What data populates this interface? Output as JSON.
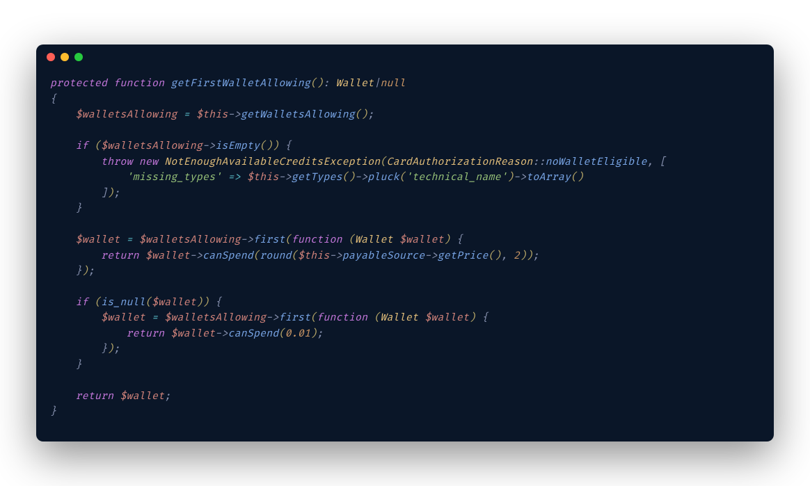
{
  "code": {
    "lines": [
      {
        "indent": 0,
        "tokens": [
          {
            "t": "kw",
            "v": "protected"
          },
          {
            "t": "sp",
            "v": " "
          },
          {
            "t": "kw",
            "v": "function"
          },
          {
            "t": "sp",
            "v": " "
          },
          {
            "t": "fn",
            "v": "getFirstWalletAllowing"
          },
          {
            "t": "paren",
            "v": "()"
          },
          {
            "t": "punct",
            "v": ": "
          },
          {
            "t": "type",
            "v": "Wallet"
          },
          {
            "t": "punct",
            "v": "|"
          },
          {
            "t": "null",
            "v": "null"
          }
        ]
      },
      {
        "indent": 0,
        "tokens": [
          {
            "t": "brace",
            "v": "{"
          }
        ]
      },
      {
        "indent": 1,
        "tokens": [
          {
            "t": "var",
            "v": "$walletsAllowing"
          },
          {
            "t": "sp",
            "v": " "
          },
          {
            "t": "op",
            "v": "="
          },
          {
            "t": "sp",
            "v": " "
          },
          {
            "t": "var",
            "v": "$this"
          },
          {
            "t": "arrow",
            "v": "->"
          },
          {
            "t": "method",
            "v": "getWalletsAllowing"
          },
          {
            "t": "paren",
            "v": "()"
          },
          {
            "t": "punct",
            "v": ";"
          }
        ]
      },
      {
        "indent": 0,
        "tokens": []
      },
      {
        "indent": 1,
        "tokens": [
          {
            "t": "kw",
            "v": "if"
          },
          {
            "t": "sp",
            "v": " "
          },
          {
            "t": "paren",
            "v": "("
          },
          {
            "t": "var",
            "v": "$walletsAllowing"
          },
          {
            "t": "arrow",
            "v": "->"
          },
          {
            "t": "method",
            "v": "isEmpty"
          },
          {
            "t": "paren",
            "v": "())"
          },
          {
            "t": "sp",
            "v": " "
          },
          {
            "t": "brace",
            "v": "{"
          }
        ]
      },
      {
        "indent": 2,
        "tokens": [
          {
            "t": "kw",
            "v": "throw"
          },
          {
            "t": "sp",
            "v": " "
          },
          {
            "t": "kw",
            "v": "new"
          },
          {
            "t": "sp",
            "v": " "
          },
          {
            "t": "type",
            "v": "NotEnoughAvailableCreditsException"
          },
          {
            "t": "paren",
            "v": "("
          },
          {
            "t": "type",
            "v": "CardAuthorizationReason"
          },
          {
            "t": "scope",
            "v": "::"
          },
          {
            "t": "method",
            "v": "noWalletEligible"
          },
          {
            "t": "punct",
            "v": ", "
          },
          {
            "t": "bracket",
            "v": "["
          }
        ]
      },
      {
        "indent": 3,
        "tokens": [
          {
            "t": "str",
            "v": "'missing_types'"
          },
          {
            "t": "sp",
            "v": " "
          },
          {
            "t": "op",
            "v": "=>"
          },
          {
            "t": "sp",
            "v": " "
          },
          {
            "t": "var",
            "v": "$this"
          },
          {
            "t": "arrow",
            "v": "->"
          },
          {
            "t": "method",
            "v": "getTypes"
          },
          {
            "t": "paren",
            "v": "()"
          },
          {
            "t": "arrow",
            "v": "->"
          },
          {
            "t": "method",
            "v": "pluck"
          },
          {
            "t": "paren",
            "v": "("
          },
          {
            "t": "str",
            "v": "'technical_name'"
          },
          {
            "t": "paren",
            "v": ")"
          },
          {
            "t": "arrow",
            "v": "->"
          },
          {
            "t": "method",
            "v": "toArray"
          },
          {
            "t": "paren",
            "v": "()"
          }
        ]
      },
      {
        "indent": 2,
        "tokens": [
          {
            "t": "bracket",
            "v": "]"
          },
          {
            "t": "paren",
            "v": ")"
          },
          {
            "t": "punct",
            "v": ";"
          }
        ]
      },
      {
        "indent": 1,
        "tokens": [
          {
            "t": "brace",
            "v": "}"
          }
        ]
      },
      {
        "indent": 0,
        "tokens": []
      },
      {
        "indent": 1,
        "tokens": [
          {
            "t": "var",
            "v": "$wallet"
          },
          {
            "t": "sp",
            "v": " "
          },
          {
            "t": "op",
            "v": "="
          },
          {
            "t": "sp",
            "v": " "
          },
          {
            "t": "var",
            "v": "$walletsAllowing"
          },
          {
            "t": "arrow",
            "v": "->"
          },
          {
            "t": "method",
            "v": "first"
          },
          {
            "t": "paren",
            "v": "("
          },
          {
            "t": "kw",
            "v": "function"
          },
          {
            "t": "sp",
            "v": " "
          },
          {
            "t": "paren",
            "v": "("
          },
          {
            "t": "type",
            "v": "Wallet"
          },
          {
            "t": "sp",
            "v": " "
          },
          {
            "t": "var",
            "v": "$wallet"
          },
          {
            "t": "paren",
            "v": ")"
          },
          {
            "t": "sp",
            "v": " "
          },
          {
            "t": "brace",
            "v": "{"
          }
        ]
      },
      {
        "indent": 2,
        "tokens": [
          {
            "t": "kw",
            "v": "return"
          },
          {
            "t": "sp",
            "v": " "
          },
          {
            "t": "var",
            "v": "$wallet"
          },
          {
            "t": "arrow",
            "v": "->"
          },
          {
            "t": "method",
            "v": "canSpend"
          },
          {
            "t": "paren",
            "v": "("
          },
          {
            "t": "builtin",
            "v": "round"
          },
          {
            "t": "paren",
            "v": "("
          },
          {
            "t": "var",
            "v": "$this"
          },
          {
            "t": "arrow",
            "v": "->"
          },
          {
            "t": "method",
            "v": "payableSource"
          },
          {
            "t": "arrow",
            "v": "->"
          },
          {
            "t": "method",
            "v": "getPrice"
          },
          {
            "t": "paren",
            "v": "()"
          },
          {
            "t": "punct",
            "v": ", "
          },
          {
            "t": "num",
            "v": "2"
          },
          {
            "t": "paren",
            "v": "))"
          },
          {
            "t": "punct",
            "v": ";"
          }
        ]
      },
      {
        "indent": 1,
        "tokens": [
          {
            "t": "brace",
            "v": "}"
          },
          {
            "t": "paren",
            "v": ")"
          },
          {
            "t": "punct",
            "v": ";"
          }
        ]
      },
      {
        "indent": 0,
        "tokens": []
      },
      {
        "indent": 1,
        "tokens": [
          {
            "t": "kw",
            "v": "if"
          },
          {
            "t": "sp",
            "v": " "
          },
          {
            "t": "paren",
            "v": "("
          },
          {
            "t": "builtin",
            "v": "is_null"
          },
          {
            "t": "paren",
            "v": "("
          },
          {
            "t": "var",
            "v": "$wallet"
          },
          {
            "t": "paren",
            "v": "))"
          },
          {
            "t": "sp",
            "v": " "
          },
          {
            "t": "brace",
            "v": "{"
          }
        ]
      },
      {
        "indent": 2,
        "tokens": [
          {
            "t": "var",
            "v": "$wallet"
          },
          {
            "t": "sp",
            "v": " "
          },
          {
            "t": "op",
            "v": "="
          },
          {
            "t": "sp",
            "v": " "
          },
          {
            "t": "var",
            "v": "$walletsAllowing"
          },
          {
            "t": "arrow",
            "v": "->"
          },
          {
            "t": "method",
            "v": "first"
          },
          {
            "t": "paren",
            "v": "("
          },
          {
            "t": "kw",
            "v": "function"
          },
          {
            "t": "sp",
            "v": " "
          },
          {
            "t": "paren",
            "v": "("
          },
          {
            "t": "type",
            "v": "Wallet"
          },
          {
            "t": "sp",
            "v": " "
          },
          {
            "t": "var",
            "v": "$wallet"
          },
          {
            "t": "paren",
            "v": ")"
          },
          {
            "t": "sp",
            "v": " "
          },
          {
            "t": "brace",
            "v": "{"
          }
        ]
      },
      {
        "indent": 3,
        "tokens": [
          {
            "t": "kw",
            "v": "return"
          },
          {
            "t": "sp",
            "v": " "
          },
          {
            "t": "var",
            "v": "$wallet"
          },
          {
            "t": "arrow",
            "v": "->"
          },
          {
            "t": "method",
            "v": "canSpend"
          },
          {
            "t": "paren",
            "v": "("
          },
          {
            "t": "num",
            "v": "0.01"
          },
          {
            "t": "paren",
            "v": ")"
          },
          {
            "t": "punct",
            "v": ";"
          }
        ]
      },
      {
        "indent": 2,
        "tokens": [
          {
            "t": "brace",
            "v": "}"
          },
          {
            "t": "paren",
            "v": ")"
          },
          {
            "t": "punct",
            "v": ";"
          }
        ]
      },
      {
        "indent": 1,
        "tokens": [
          {
            "t": "brace",
            "v": "}"
          }
        ]
      },
      {
        "indent": 0,
        "tokens": []
      },
      {
        "indent": 1,
        "tokens": [
          {
            "t": "kw",
            "v": "return"
          },
          {
            "t": "sp",
            "v": " "
          },
          {
            "t": "var",
            "v": "$wallet"
          },
          {
            "t": "punct",
            "v": ";"
          }
        ]
      },
      {
        "indent": 0,
        "tokens": [
          {
            "t": "brace",
            "v": "}"
          }
        ]
      }
    ]
  }
}
